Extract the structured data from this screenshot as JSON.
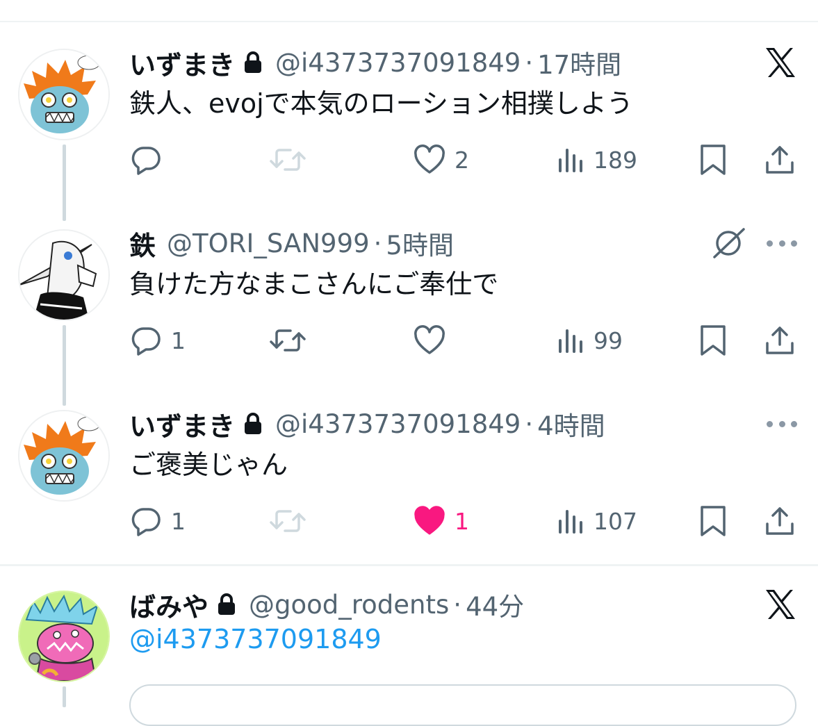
{
  "tweets": [
    {
      "name": "いずまき",
      "locked": true,
      "handle": "@i4373737091849",
      "separator": "·",
      "time": "17時間",
      "text": "鉄人、evojで本気のローション相撲しよう",
      "reply_count": "",
      "retweet_count": "",
      "like_count": "2",
      "view_count": "189",
      "liked": false,
      "header_icon": "x-logo-icon"
    },
    {
      "name": "鉄",
      "locked": false,
      "handle": "@TORI_SAN999",
      "separator": "·",
      "time": "5時間",
      "text": "負けた方なまこさんにご奉仕で",
      "reply_count": "1",
      "retweet_count": "",
      "like_count": "",
      "view_count": "99",
      "liked": false,
      "header_icon": "grok-icon"
    },
    {
      "name": "いずまき",
      "locked": true,
      "handle": "@i4373737091849",
      "separator": "·",
      "time": "4時間",
      "text": "ご褒美じゃん",
      "reply_count": "1",
      "retweet_count": "",
      "like_count": "1",
      "view_count": "107",
      "liked": true,
      "header_icon": "more-icon"
    },
    {
      "name": "ばみや",
      "locked": true,
      "handle": "@good_rodents",
      "separator": "·",
      "time": "44分",
      "mention": "@i4373737091849",
      "header_icon": "x-logo-icon"
    }
  ],
  "colors": {
    "like_active": "#f91880",
    "mention": "#1d9bf0",
    "secondary_text": "#536471",
    "divider": "#eff3f4"
  }
}
